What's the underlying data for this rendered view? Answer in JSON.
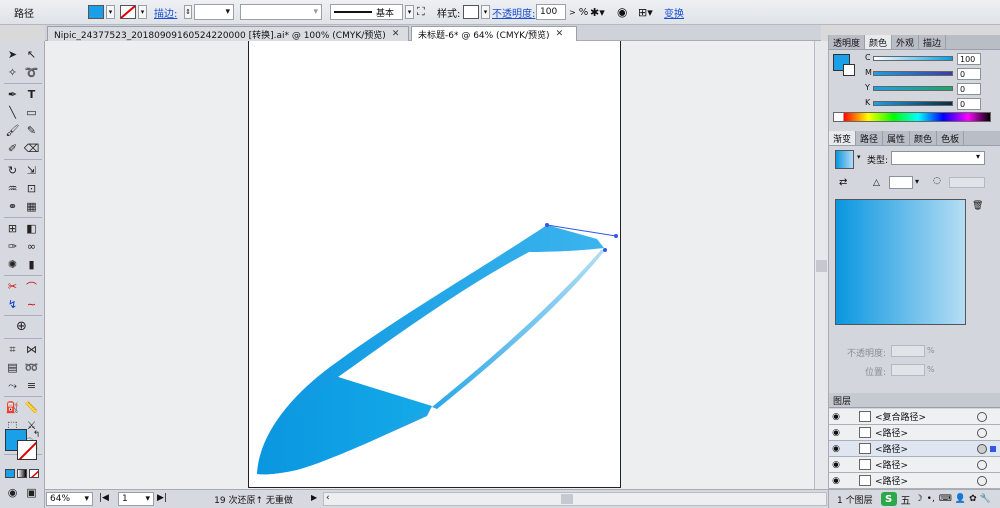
{
  "control_bar": {
    "object_type": "路径",
    "stroke_label": "描边:",
    "stroke_profile": "基本",
    "style_label": "样式:",
    "opacity_label": "不透明度:",
    "opacity_value": "100",
    "opacity_unit": "%",
    "transform_label": "变换"
  },
  "tabs": [
    {
      "label": "Nipic_24377523_20180909160524220000 [转换].ai* @ 100% (CMYK/预览)",
      "close": "✕"
    },
    {
      "label": "未标题-6* @ 64% (CMYK/预览)",
      "close": "✕"
    }
  ],
  "status": {
    "zoom": "64%",
    "page": "1",
    "history": "19 次还原↑ 无重做"
  },
  "color_panel": {
    "tabs": [
      "透明度",
      "颜色",
      "外观",
      "描边"
    ],
    "c_label": "C",
    "c_value": "100",
    "m_label": "M",
    "m_value": "0",
    "y_label": "Y",
    "y_value": "0",
    "k_label": "K",
    "k_value": "0"
  },
  "gradient_panel": {
    "tabs": [
      "渐变",
      "路径",
      "属性",
      "颜色",
      "色板"
    ],
    "type_label": "类型:",
    "opacity_label": "不透明度:",
    "location_label": "位置:",
    "percent": "%"
  },
  "layers_panel": {
    "title": "图层",
    "items": [
      "<复合路径>",
      "<路径>",
      "<路径>",
      "<路径>",
      "<路径>"
    ],
    "footer": "1 个图层"
  },
  "colors": {
    "accent": "#1aa0e8",
    "gradient_start": "#0a96e0",
    "gradient_end": "#b5ddf4"
  }
}
